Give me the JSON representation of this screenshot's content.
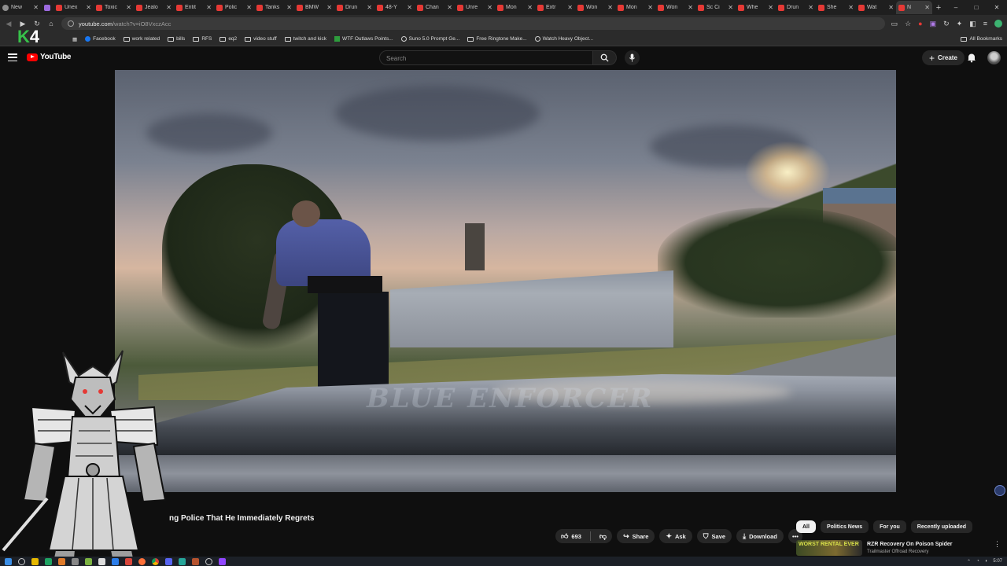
{
  "browser": {
    "tabs": [
      {
        "label": "New",
        "fav": "grey"
      },
      {
        "label": "",
        "fav": "purple",
        "pinned": true
      },
      {
        "label": "Unex"
      },
      {
        "label": "Toxic"
      },
      {
        "label": "Jealo"
      },
      {
        "label": "Entit"
      },
      {
        "label": "Polic"
      },
      {
        "label": "Tanks"
      },
      {
        "label": "BMW"
      },
      {
        "label": "Drun"
      },
      {
        "label": "48-Y"
      },
      {
        "label": "Chan"
      },
      {
        "label": "Unre"
      },
      {
        "label": "Mon"
      },
      {
        "label": "Extr"
      },
      {
        "label": "Won"
      },
      {
        "label": "Mon"
      },
      {
        "label": "Won"
      },
      {
        "label": "Sc Ci"
      },
      {
        "label": "Whe"
      },
      {
        "label": "Drun"
      },
      {
        "label": "She"
      },
      {
        "label": "Wat"
      },
      {
        "label": "N",
        "active": true
      }
    ],
    "new_tab_label": "+",
    "window_controls": [
      "–",
      "□",
      "✕"
    ],
    "url_host": "youtube.com",
    "url_path": "/watch?v=iO8VxczAcc",
    "bookmarks": [
      {
        "label": "Facebook",
        "icon": "facebook-icon"
      },
      {
        "label": "work related",
        "icon": "folder-icon"
      },
      {
        "label": "bills",
        "icon": "folder-icon"
      },
      {
        "label": "RFS",
        "icon": "folder-icon"
      },
      {
        "label": "eq2",
        "icon": "folder-icon"
      },
      {
        "label": "video stuff",
        "icon": "folder-icon"
      },
      {
        "label": "twitch and kick",
        "icon": "folder-icon"
      },
      {
        "label": "WTF Outlaws Points...",
        "icon": "green-square-icon"
      },
      {
        "label": "Suno 5.0 Prompt Ge...",
        "icon": "globe-icon"
      },
      {
        "label": "Free Ringtone Make...",
        "icon": "page-icon"
      },
      {
        "label": "Watch Heavy Object...",
        "icon": "globe-icon"
      }
    ],
    "all_bookmarks_label": "All Bookmarks"
  },
  "overlay": {
    "logo_k": "K",
    "logo_num": "4"
  },
  "youtube": {
    "logo_text": "YouTube",
    "search_placeholder": "Search",
    "create_label": "Create",
    "video": {
      "watermark": "BLUE ENFORCER",
      "title_visible": "ng Police That He Immediately Regrets",
      "like_count": "693",
      "share_label": "Share",
      "ask_label": "Ask",
      "save_label": "Save",
      "download_label": "Download",
      "more_label": "•••"
    },
    "chips": [
      {
        "label": "All",
        "active": true
      },
      {
        "label": "Politics News"
      },
      {
        "label": "For you"
      },
      {
        "label": "Recently uploaded"
      }
    ],
    "recommendation": {
      "thumb_text": "WORST RENTAL EVER",
      "title": "RZR Recovery On Poison Spider",
      "channel": "Trailmaster Offroad Recovery"
    }
  },
  "taskbar": {
    "time": "5:07"
  },
  "colors": {
    "youtube_red": "#ff0000",
    "background": "#0f0f0f",
    "pill_bg": "#272727",
    "k4_green": "#37c14a"
  }
}
